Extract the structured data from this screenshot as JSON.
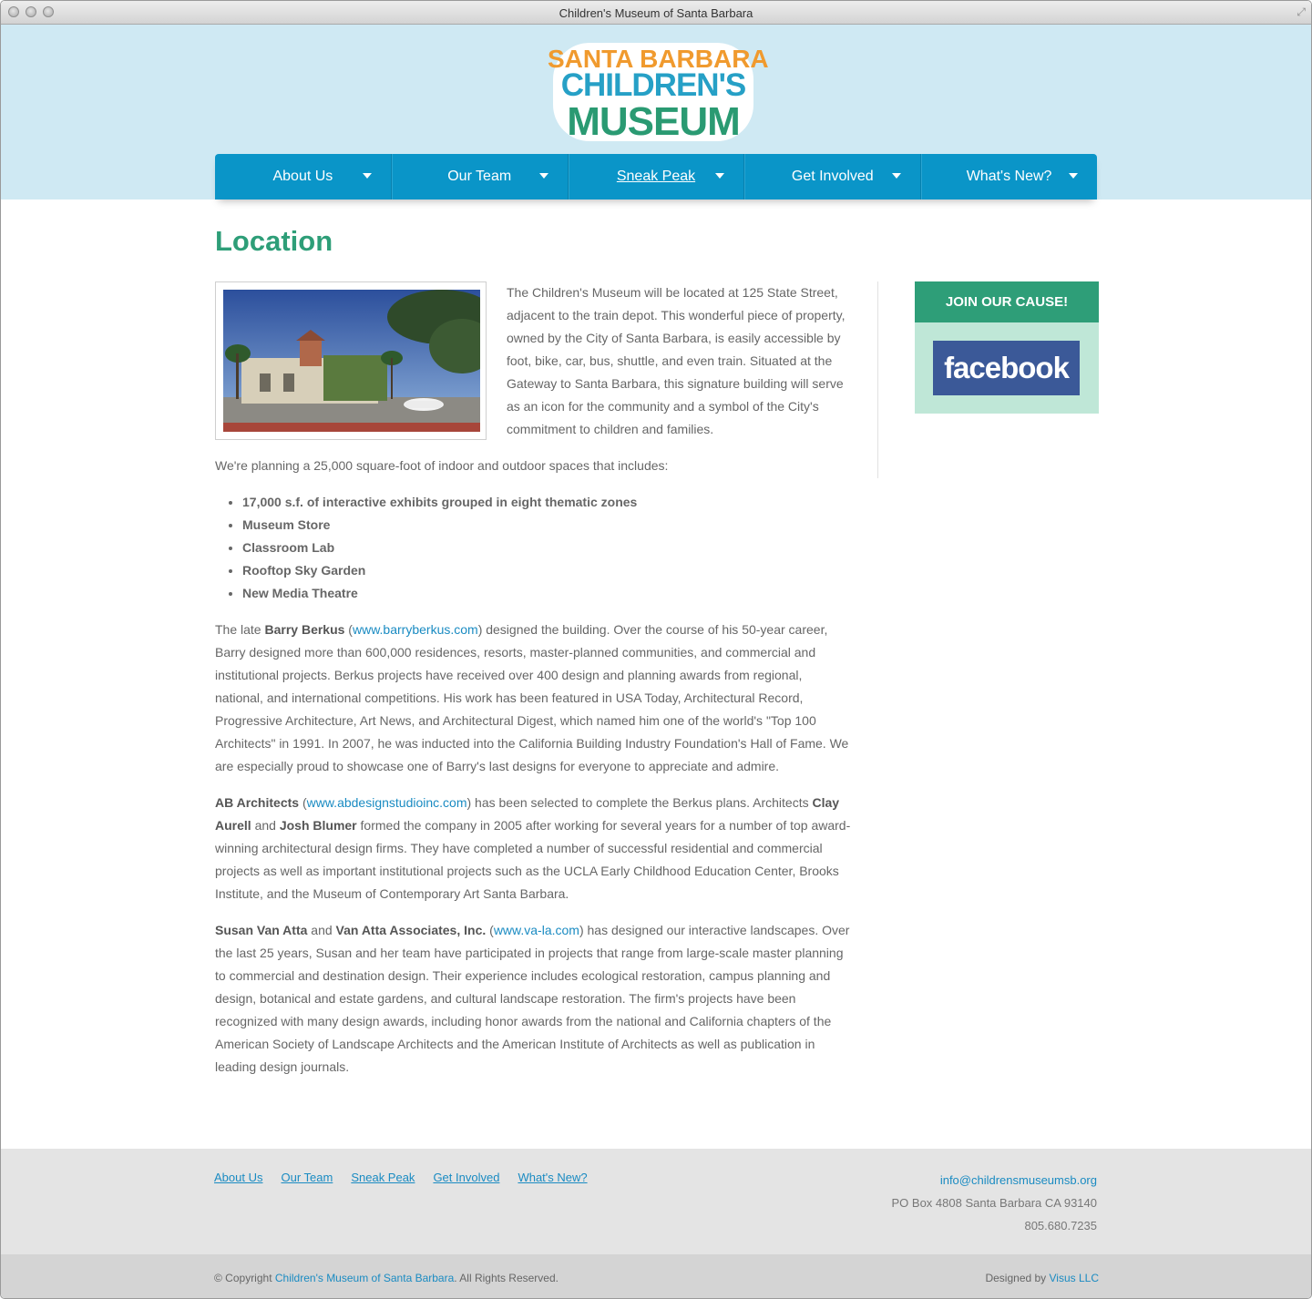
{
  "window": {
    "title": "Children's Museum of Santa Barbara"
  },
  "logo": {
    "line1": "SANTA BARBARA",
    "line2": "CHILDREN'S",
    "line3": "MUSEUM"
  },
  "nav": {
    "items": [
      {
        "label": "About Us"
      },
      {
        "label": "Our Team"
      },
      {
        "label": "Sneak Peak"
      },
      {
        "label": "Get Involved"
      },
      {
        "label": "What's New?"
      }
    ],
    "active": "Sneak Peak"
  },
  "page": {
    "title": "Location",
    "intro": "The Children's Museum will be located at 125 State Street, adjacent to the train depot. This wonderful piece of property, owned by the City of Santa Barbara, is easily accessible by foot, bike, car, bus, shuttle, and even train. Situated at the Gateway to Santa Barbara, this signature building will serve as an icon for the community and a symbol of the City's commitment to children and families.",
    "planning": "We're planning a 25,000 square-foot of indoor and outdoor spaces that includes:",
    "features": [
      "17,000 s.f. of interactive exhibits grouped in eight thematic zones",
      "Museum Store",
      "Classroom Lab",
      "Rooftop Sky Garden",
      "New Media Theatre"
    ],
    "berkus": {
      "pre": "The late ",
      "name": "Barry Berkus",
      "open": " (",
      "link": "www.barryberkus.com",
      "rest": ") designed the building. Over the course of his 50-year career, Barry designed more than 600,000 residences, resorts, master-planned communities, and commercial and institutional projects. Berkus projects have received over 400 design and planning awards from regional, national, and international competitions. His work has been featured in USA Today, Architectural Record, Progressive Architecture, Art News, and Architectural Digest, which named him one of the world's \"Top 100 Architects\" in 1991. In 2007, he was inducted into the California Building Industry Foundation's Hall of Fame. We are especially proud to showcase one of Barry's last designs for everyone to appreciate and admire."
    },
    "ab": {
      "name": "AB Architects",
      "open": " (",
      "link": "www.abdesignstudioinc.com",
      "mid": ") has been selected to complete the Berkus plans. Architects ",
      "name2": "Clay Aurell",
      "and": " and ",
      "name3": "Josh Blumer",
      "rest": " formed the company in 2005 after working for several years for a number of top award-winning architectural design firms. They have completed a number of successful residential and commercial projects as well as important institutional projects such as the UCLA Early Childhood Education Center, Brooks Institute, and the Museum of Contemporary Art Santa Barbara."
    },
    "vanatta": {
      "name": "Susan Van Atta",
      "and": " and ",
      "name2": "Van Atta Associates, Inc.",
      "open": " (",
      "link": "www.va-la.com",
      "rest": ") has designed our interactive landscapes. Over the last 25 years, Susan and her team have participated in projects that range from large-scale master planning to commercial and destination design. Their experience includes ecological restoration, campus planning and design, botanical and estate gardens, and cultural landscape restoration. The firm's projects have been recognized with many design awards, including honor awards from the national and California chapters of the American Society of Landscape Architects and the American Institute of Architects as well as publication in leading design journals."
    }
  },
  "sidebar": {
    "join_label": "JOIN OUR CAUSE!",
    "facebook_label": "facebook"
  },
  "footer": {
    "links": [
      "About Us",
      "Our Team",
      "Sneak Peak",
      "Get Involved",
      "What's New?"
    ],
    "email": "info@childrensmuseumsb.org",
    "address": "PO Box 4808 Santa Barbara CA 93140",
    "phone": "805.680.7235",
    "copyright_pre": "© Copyright ",
    "copyright_link": "Children's Museum of Santa Barbara",
    "copyright_post": ". All Rights Reserved.",
    "designed_pre": "Designed by ",
    "designed_link": "Visus LLC"
  },
  "colors": {
    "accent_green": "#2e9e78",
    "nav_blue": "#0a95c8",
    "header_bg": "#cfe9f3",
    "link": "#1a8bc2",
    "facebook": "#3b5998"
  }
}
